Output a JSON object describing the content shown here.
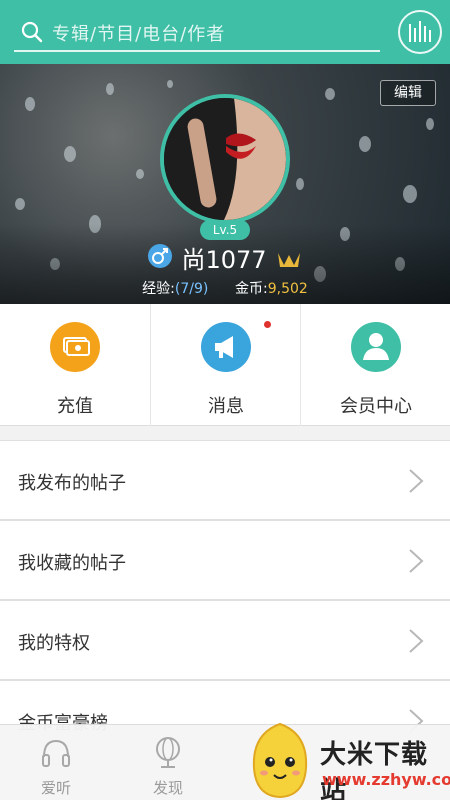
{
  "search": {
    "placeholder": "专辑/节目/电台/作者"
  },
  "profile": {
    "edit_label": "编辑",
    "level": "Lv.5",
    "username": "尚1077",
    "exp_label": "经验:",
    "exp_value": "(7/9)",
    "gold_label": "金币:",
    "gold_value": "9,502"
  },
  "quick_actions": [
    {
      "label": "充值",
      "color": "#f5a21b"
    },
    {
      "label": "消息",
      "color": "#3aa4dd"
    },
    {
      "label": "会员中心",
      "color": "#3ebfa6"
    }
  ],
  "menu": [
    {
      "label": "我发布的帖子"
    },
    {
      "label": "我收藏的帖子"
    },
    {
      "label": "我的特权"
    },
    {
      "label": "金币富豪榜"
    }
  ],
  "bottom_nav": [
    {
      "label": "爱听"
    },
    {
      "label": "发现"
    }
  ],
  "watermark": {
    "title": "大米下载站",
    "url": "www.zzhyw.com"
  },
  "colors": {
    "accent": "#3ebfa6",
    "badge": "#e0322e"
  }
}
